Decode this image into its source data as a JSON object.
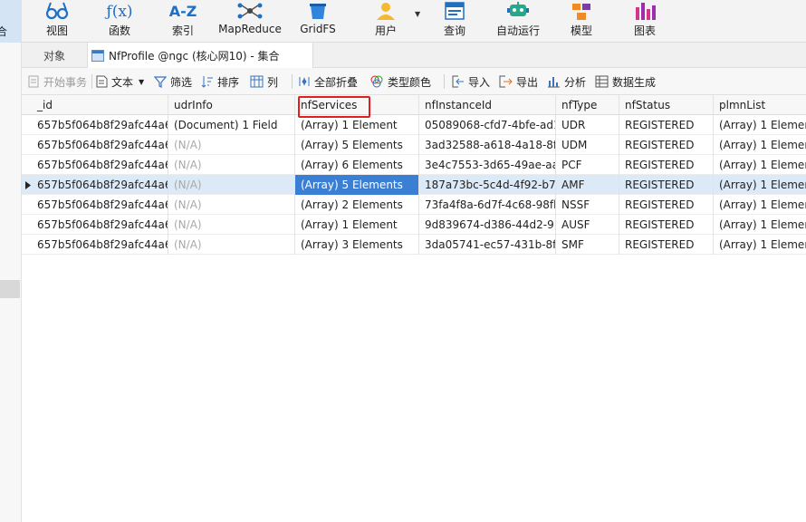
{
  "ribbon": {
    "active_label": "合",
    "items": [
      {
        "label": "视图",
        "icon": "glasses-icon"
      },
      {
        "label": "函数",
        "icon": "function-icon",
        "icon_text": "ƒ(x)"
      },
      {
        "label": "索引",
        "icon": "index-icon",
        "icon_text": "A-Z"
      },
      {
        "label": "MapReduce",
        "icon": "mapreduce-icon"
      },
      {
        "label": "GridFS",
        "icon": "gridfs-icon"
      },
      {
        "label": "用户",
        "icon": "user-icon"
      },
      {
        "label": "查询",
        "icon": "query-icon"
      },
      {
        "label": "自动运行",
        "icon": "robot-icon"
      },
      {
        "label": "模型",
        "icon": "model-icon"
      },
      {
        "label": "图表",
        "icon": "chart-icon"
      }
    ]
  },
  "tabs": {
    "objects": "对象",
    "active": "NfProfile @ngc (核心网10) - 集合"
  },
  "toolbar": {
    "begin_transaction": "开始事务",
    "text": "文本",
    "filter": "筛选",
    "sort": "排序",
    "columns": "列",
    "collapse_all": "全部折叠",
    "type_colors": "类型颜色",
    "import": "导入",
    "export": "导出",
    "analyze": "分析",
    "generate_data": "数据生成"
  },
  "grid": {
    "columns": [
      "_id",
      "udrInfo",
      "nfServices",
      "nfInstanceId",
      "nfType",
      "nfStatus",
      "plmnList"
    ],
    "rows": [
      {
        "id": "657b5f064b8f29afc44a6",
        "udrInfo": "(Document) 1 Field",
        "nfServices": "(Array) 1 Element",
        "nfInstanceId": "05089068-cfd7-4bfe-ad1",
        "nfType": "UDR",
        "nfStatus": "REGISTERED",
        "plmnList": "(Array) 1 Elemen"
      },
      {
        "id": "657b5f064b8f29afc44a6",
        "udrInfo": "(N/A)",
        "nfServices": "(Array) 5 Elements",
        "nfInstanceId": "3ad32588-a618-4a18-8f",
        "nfType": "UDM",
        "nfStatus": "REGISTERED",
        "plmnList": "(Array) 1 Elemen"
      },
      {
        "id": "657b5f064b8f29afc44a6",
        "udrInfo": "(N/A)",
        "nfServices": "(Array) 6 Elements",
        "nfInstanceId": "3e4c7553-3d65-49ae-aa",
        "nfType": "PCF",
        "nfStatus": "REGISTERED",
        "plmnList": "(Array) 1 Elemen"
      },
      {
        "id": "657b5f064b8f29afc44a6",
        "udrInfo": "(N/A)",
        "nfServices": "(Array) 5 Elements",
        "nfInstanceId": "187a73bc-5c4d-4f92-b7",
        "nfType": "AMF",
        "nfStatus": "REGISTERED",
        "plmnList": "(Array) 1 Elemen"
      },
      {
        "id": "657b5f064b8f29afc44a6",
        "udrInfo": "(N/A)",
        "nfServices": "(Array) 2 Elements",
        "nfInstanceId": "73fa4f8a-6d7f-4c68-98fk",
        "nfType": "NSSF",
        "nfStatus": "REGISTERED",
        "plmnList": "(Array) 1 Elemen"
      },
      {
        "id": "657b5f064b8f29afc44a6",
        "udrInfo": "(N/A)",
        "nfServices": "(Array) 1 Element",
        "nfInstanceId": "9d839674-d386-44d2-9",
        "nfType": "AUSF",
        "nfStatus": "REGISTERED",
        "plmnList": "(Array) 1 Elemen"
      },
      {
        "id": "657b5f064b8f29afc44a6",
        "udrInfo": "(N/A)",
        "nfServices": "(Array) 3 Elements",
        "nfInstanceId": "3da05741-ec57-431b-8f",
        "nfType": "SMF",
        "nfStatus": "REGISTERED",
        "plmnList": "(Array) 1 Elemen"
      }
    ],
    "selected_row": 3,
    "highlighted_column": "nfServices",
    "null_color": "#a8a8a8",
    "selection_color": "#3b7fd4",
    "highlight_box_color": "#e02020"
  }
}
